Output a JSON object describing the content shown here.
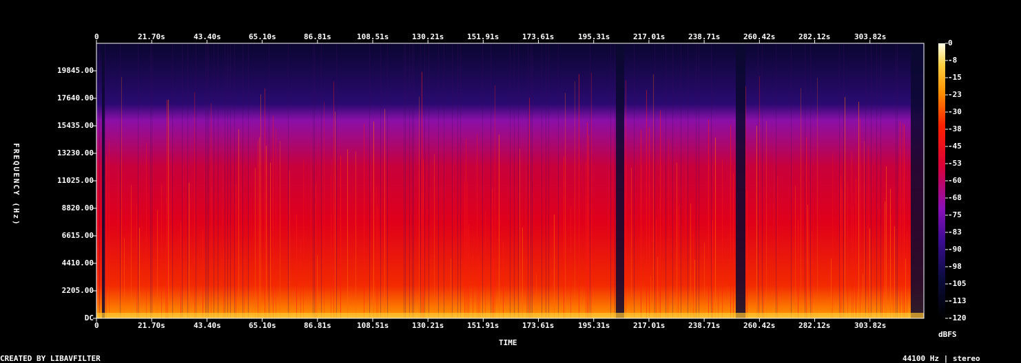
{
  "chart_data": {
    "type": "heatmap",
    "xlabel": "TIME",
    "ylabel": "FREQUENCY (Hz)",
    "x_ticks": [
      "0",
      "21.70s",
      "43.40s",
      "65.10s",
      "86.81s",
      "108.51s",
      "130.21s",
      "151.91s",
      "173.61s",
      "195.31s",
      "217.01s",
      "238.71s",
      "260.42s",
      "282.12s",
      "303.82s"
    ],
    "x_tick_values": [
      0,
      21.7,
      43.4,
      65.1,
      86.81,
      108.51,
      130.21,
      151.91,
      173.61,
      195.31,
      217.01,
      238.71,
      260.42,
      282.12,
      303.82
    ],
    "xlim": [
      0,
      325
    ],
    "y_ticks": [
      "DC",
      "2205.00",
      "4410.00",
      "6615.00",
      "8820.00",
      "11025.00",
      "13230.00",
      "15435.00",
      "17640.00",
      "19845.00"
    ],
    "y_tick_values": [
      0,
      2205,
      4410,
      6615,
      8820,
      11025,
      13230,
      15435,
      17640,
      19845
    ],
    "ylim": [
      0,
      22050
    ],
    "colorbar": {
      "unit": "dBFS",
      "ticks": [
        "0",
        "-8",
        "-15",
        "-23",
        "-30",
        "-38",
        "-45",
        "-53",
        "-60",
        "-68",
        "-75",
        "-83",
        "-90",
        "-98",
        "-105",
        "-113",
        "-120"
      ],
      "range": [
        -120,
        0
      ]
    },
    "colors": {
      "low": "#000000",
      "mid_low": "#1a0a5c",
      "mid": "#8a0fb8",
      "mid_high": "#e8001c",
      "high": "#ffb400",
      "peak": "#ffffe0"
    }
  },
  "footer": {
    "left": "CREATED BY LIBAVFILTER",
    "right": "44100 Hz | stereo"
  }
}
